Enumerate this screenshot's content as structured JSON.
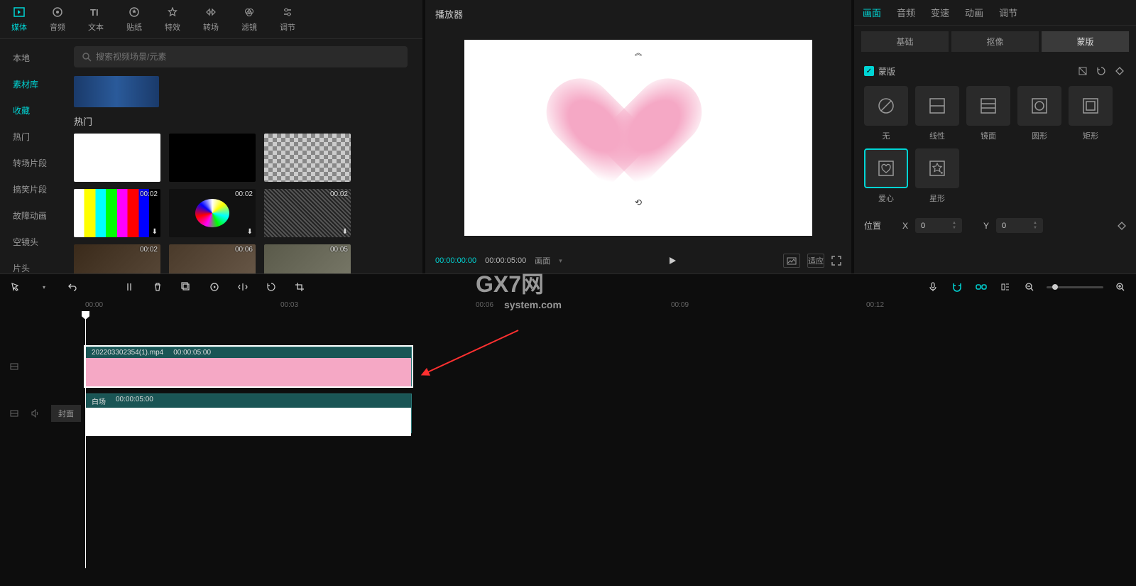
{
  "toolbar": [
    {
      "id": "media",
      "label": "媒体",
      "active": true
    },
    {
      "id": "audio",
      "label": "音频"
    },
    {
      "id": "text",
      "label": "文本"
    },
    {
      "id": "sticker",
      "label": "贴纸"
    },
    {
      "id": "effect",
      "label": "特效"
    },
    {
      "id": "transition",
      "label": "转场"
    },
    {
      "id": "filter",
      "label": "滤镜"
    },
    {
      "id": "adjust",
      "label": "调节"
    }
  ],
  "sidebar": [
    {
      "id": "local",
      "label": "本地"
    },
    {
      "id": "library",
      "label": "素材库",
      "active": true
    },
    {
      "id": "favorite",
      "label": "收藏",
      "highlight": true
    },
    {
      "id": "hot",
      "label": "热门"
    },
    {
      "id": "transition-clip",
      "label": "转场片段"
    },
    {
      "id": "funny-clip",
      "label": "搞笑片段"
    },
    {
      "id": "glitch",
      "label": "故障动画"
    },
    {
      "id": "empty-shot",
      "label": "空镜头"
    },
    {
      "id": "opening",
      "label": "片头"
    }
  ],
  "search": {
    "placeholder": "搜索视频场景/元素"
  },
  "section_title": "热门",
  "thumbs": {
    "row2": [
      {
        "dur": "00:02"
      },
      {
        "dur": "00:02"
      },
      {
        "dur": "00:02"
      }
    ],
    "row3": [
      {
        "dur": "00:02"
      },
      {
        "dur": "00:06"
      },
      {
        "dur": "00:05"
      }
    ]
  },
  "player": {
    "title": "播放器",
    "time_current": "00:00:00:00",
    "time_total": "00:00:05:00",
    "ratio_label": "画面",
    "btn_ratio": "适应"
  },
  "right_tabs": [
    {
      "id": "canvas",
      "label": "画面",
      "active": true
    },
    {
      "id": "audio",
      "label": "音频"
    },
    {
      "id": "speed",
      "label": "变速"
    },
    {
      "id": "anim",
      "label": "动画"
    },
    {
      "id": "adjust",
      "label": "调节"
    }
  ],
  "subtabs": [
    {
      "id": "basic",
      "label": "基础"
    },
    {
      "id": "cutout",
      "label": "抠像"
    },
    {
      "id": "mask",
      "label": "蒙版",
      "active": true
    }
  ],
  "mask": {
    "checkbox_label": "蒙版",
    "shapes": [
      {
        "id": "none",
        "label": "无"
      },
      {
        "id": "linear",
        "label": "线性"
      },
      {
        "id": "mirror",
        "label": "镜面"
      },
      {
        "id": "circle",
        "label": "圆形"
      },
      {
        "id": "rect",
        "label": "矩形"
      },
      {
        "id": "heart",
        "label": "爱心",
        "active": true
      },
      {
        "id": "star",
        "label": "星形"
      }
    ]
  },
  "position": {
    "label": "位置",
    "x_label": "X",
    "x_val": "0",
    "y_label": "Y",
    "y_val": "0"
  },
  "timeline": {
    "ruler": [
      "00:00",
      "00:03",
      "00:06",
      "00:09",
      "00:12"
    ],
    "cover_btn": "封面",
    "clip1": {
      "name": "202203302354(1).mp4",
      "dur": "00:00:05:00"
    },
    "clip2": {
      "name": "白场",
      "dur": "00:00:05:00"
    }
  },
  "watermark": {
    "main": "GX7网",
    "sub": "system.com"
  }
}
